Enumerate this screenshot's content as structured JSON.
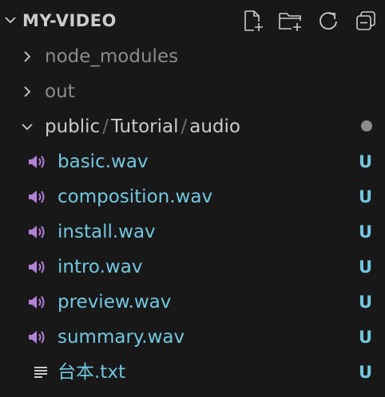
{
  "explorer": {
    "title": "MY-VIDEO",
    "actions": [
      {
        "name": "new-file-icon"
      },
      {
        "name": "new-folder-icon"
      },
      {
        "name": "refresh-icon"
      },
      {
        "name": "collapse-all-icon"
      }
    ]
  },
  "tree": {
    "node_modules": "node_modules",
    "out": "out",
    "public_path": {
      "part1": "public",
      "sep1": "/",
      "part2": "Tutorial",
      "sep2": "/",
      "part3": "audio"
    },
    "files": [
      {
        "label": "basic.wav",
        "status": "U",
        "icon": "audio-file-icon"
      },
      {
        "label": "composition.wav",
        "status": "U",
        "icon": "audio-file-icon"
      },
      {
        "label": "install.wav",
        "status": "U",
        "icon": "audio-file-icon"
      },
      {
        "label": "intro.wav",
        "status": "U",
        "icon": "audio-file-icon"
      },
      {
        "label": "preview.wav",
        "status": "U",
        "icon": "audio-file-icon"
      },
      {
        "label": "summary.wav",
        "status": "U",
        "icon": "audio-file-icon"
      },
      {
        "label": "台本.txt",
        "status": "U",
        "icon": "text-file-icon"
      }
    ]
  },
  "colors": {
    "background": "#181818",
    "untracked": "#73c7e0",
    "audio_icon": "#b180d7"
  }
}
